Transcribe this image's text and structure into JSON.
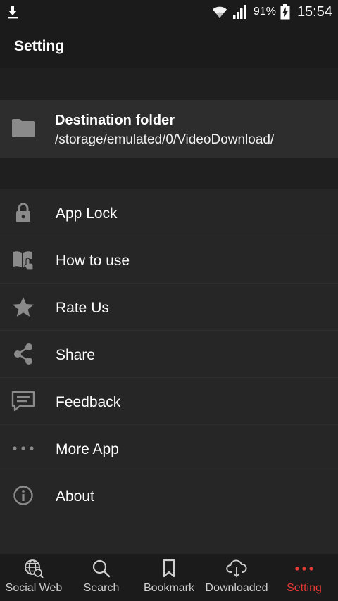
{
  "status": {
    "battery_pct": "91%",
    "time": "15:54"
  },
  "header": {
    "title": "Setting"
  },
  "destination": {
    "title": "Destination folder",
    "path": "/storage/emulated/0/VideoDownload/",
    "icon": "folder-icon"
  },
  "menu": {
    "items": [
      {
        "label": "App Lock",
        "icon": "lock-icon"
      },
      {
        "label": "How to use",
        "icon": "book-icon"
      },
      {
        "label": "Rate Us",
        "icon": "star-icon"
      },
      {
        "label": "Share",
        "icon": "share-icon"
      },
      {
        "label": "Feedback",
        "icon": "feedback-icon"
      },
      {
        "label": "More App",
        "icon": "more-dots-icon"
      },
      {
        "label": "About",
        "icon": "info-icon"
      }
    ]
  },
  "nav": {
    "items": [
      {
        "label": "Social Web",
        "icon": "globe-search-icon"
      },
      {
        "label": "Search",
        "icon": "search-icon"
      },
      {
        "label": "Bookmark",
        "icon": "bookmark-icon"
      },
      {
        "label": "Downloaded",
        "icon": "cloud-download-icon"
      },
      {
        "label": "Setting",
        "icon": "more-dots-icon",
        "active": true
      }
    ]
  },
  "colors": {
    "accent": "#e53935",
    "icon": "#8a8a8a",
    "background": "#262626"
  }
}
